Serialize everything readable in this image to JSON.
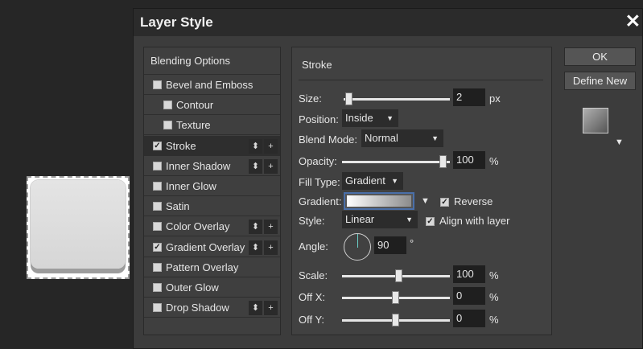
{
  "dialog": {
    "title": "Layer Style",
    "close_icon": "close-icon",
    "ok_label": "OK",
    "define_new_label": "Define New"
  },
  "styles": {
    "header": "Blending Options",
    "items": [
      {
        "label": "Bevel and Emboss",
        "checked": false,
        "sub": false,
        "buttons": false
      },
      {
        "label": "Contour",
        "checked": false,
        "sub": true,
        "buttons": false
      },
      {
        "label": "Texture",
        "checked": false,
        "sub": true,
        "buttons": false
      },
      {
        "label": "Stroke",
        "checked": true,
        "sub": false,
        "buttons": true,
        "selected": true
      },
      {
        "label": "Inner Shadow",
        "checked": false,
        "sub": false,
        "buttons": true
      },
      {
        "label": "Inner Glow",
        "checked": false,
        "sub": false,
        "buttons": false
      },
      {
        "label": "Satin",
        "checked": false,
        "sub": false,
        "buttons": false
      },
      {
        "label": "Color Overlay",
        "checked": false,
        "sub": false,
        "buttons": true
      },
      {
        "label": "Gradient Overlay",
        "checked": true,
        "sub": false,
        "buttons": true
      },
      {
        "label": "Pattern Overlay",
        "checked": false,
        "sub": false,
        "buttons": false
      },
      {
        "label": "Outer Glow",
        "checked": false,
        "sub": false,
        "buttons": false
      },
      {
        "label": "Drop Shadow",
        "checked": false,
        "sub": false,
        "buttons": true
      }
    ],
    "move_glyph": "⬍",
    "add_glyph": "+"
  },
  "stroke": {
    "section_title": "Stroke",
    "size_label": "Size:",
    "size_value": "2",
    "size_unit": "px",
    "position_label": "Position:",
    "position_value": "Inside",
    "blend_mode_label": "Blend Mode:",
    "blend_mode_value": "Normal",
    "opacity_label": "Opacity:",
    "opacity_value": "100",
    "opacity_unit": "%",
    "fill_type_label": "Fill Type:",
    "fill_type_value": "Gradient",
    "gradient_label": "Gradient:",
    "reverse_label": "Reverse",
    "reverse_checked": true,
    "style_label": "Style:",
    "style_value": "Linear",
    "align_label": "Align with layer",
    "align_checked": true,
    "angle_label": "Angle:",
    "angle_value": "90",
    "angle_unit": "°",
    "scale_label": "Scale:",
    "scale_value": "100",
    "scale_unit": "%",
    "offx_label": "Off X:",
    "offx_value": "0",
    "offx_unit": "%",
    "offy_label": "Off Y:",
    "offy_value": "0",
    "offy_unit": "%"
  },
  "colors": {
    "dialog_bg": "#3c3c3c",
    "titlebar_bg": "#2b2b2b",
    "field_bg": "#1f1f1f",
    "accent_border": "#4a6fa8"
  }
}
